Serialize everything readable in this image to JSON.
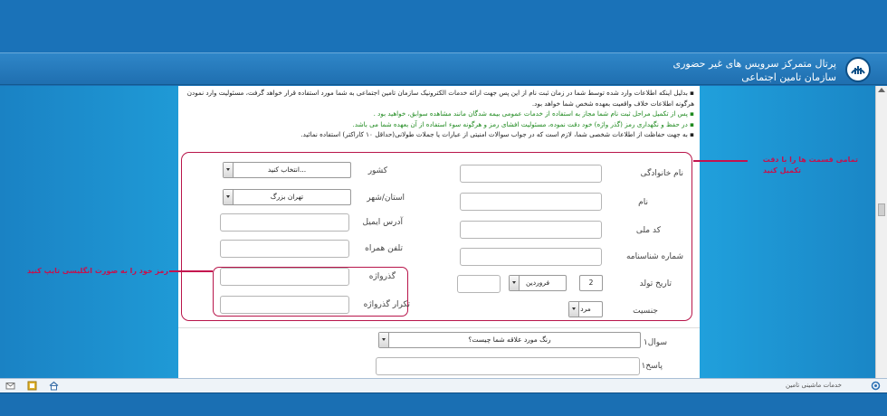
{
  "header": {
    "title": "پرتال متمرکز سرویس های غیر حضوری",
    "subtitle": "سازمان تامین اجتماعی"
  },
  "notes": [
    "بدلیل اینکه اطلاعات وارد شده توسط شما در زمان ثبت نام از این پس جهت ارائه خدمات الکترونیک سازمان تامین اجتماعی به شما مورد استفاده قرار خواهد گرفت، مسئولیت وارد نمودن هرگونه اطلاعات خلاف واقعیت بعهده شخص شما خواهد بود.",
    "پس از تکمیل مراحل ثبت نام شما مجاز به استفاده از خدمات عمومی بیمه شدگان مانند مشاهده سوابق، خواهید بود .",
    "در حفظ و نگهداری رمز (گذر واژه) خود دقت نموده، مسئولیت افشای رمز و هرگونه سوء استفاده از آن بعهده شما می باشد.",
    "به جهت حفاظت از اطلاعات شخصی شما، لازم است که در جواب سوالات امنیتی از عبارات یا جملات طولانی(حداقل ۱۰ کاراکتر) استفاده نمائید."
  ],
  "form": {
    "family_name_label": "نام خانوادگی",
    "first_name_label": "نام",
    "national_code_label": "کد ملی",
    "id_number_label": "شماره شناسنامه",
    "birth_date_label": "تاریخ تولد",
    "birth_day": "2",
    "birth_month": "فروردین",
    "gender_label": "جنسیت",
    "gender_value": "مرد",
    "country_label": "کشور",
    "country_value": "انتخاب کنید...",
    "province_label": "استان/شهر",
    "province_value": "تهران بزرگ",
    "email_label": "آدرس ایمیل",
    "mobile_label": "تلفن همراه",
    "password_label": "گذرواژه",
    "password_confirm_label": "تکرار گذرواژه",
    "question1_label": "سوال۱",
    "question1_value": "رنگ مورد علاقه شما چیست؟",
    "answer1_label": "پاسخ۱"
  },
  "annotations": {
    "fill_all": "تمامی قسمت ها را با دقت",
    "fill_all_2": "تکمیل کنید",
    "password_english": "رمز خود را به صورت انگلیسی تایپ کنید"
  },
  "status": {
    "text": "خدمات ماشینی تامین"
  },
  "colors": {
    "header_blue": "#1f6fb0",
    "annotation_red": "#c4124e",
    "note_green": "#1f8a1f"
  }
}
